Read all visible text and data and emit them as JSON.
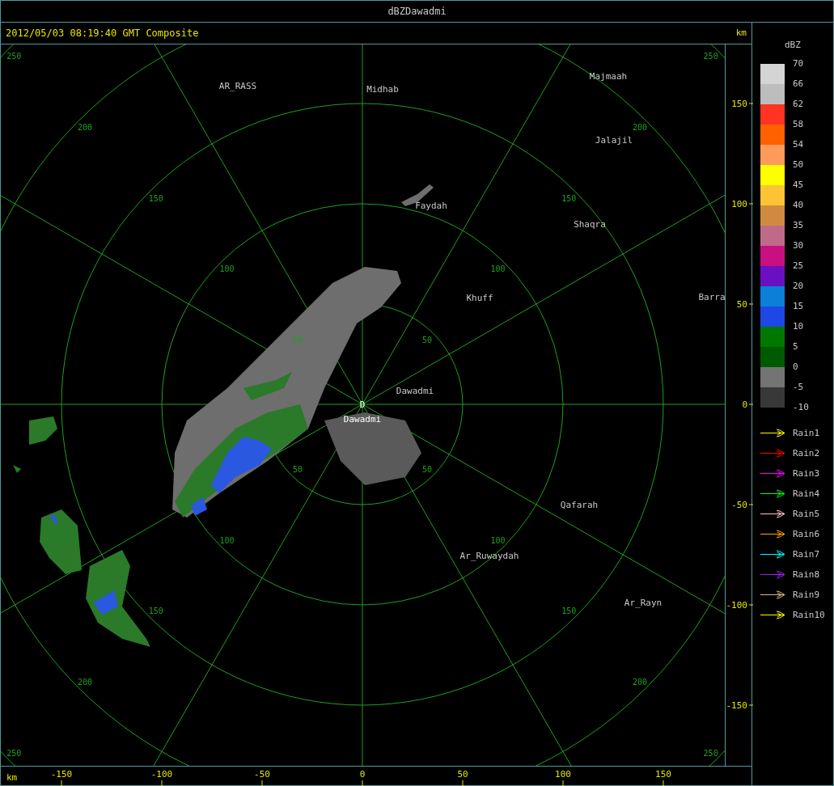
{
  "window": {
    "title": "dBZDawadmi"
  },
  "header": {
    "timestamp": "2012/05/03 08:19:40 GMT Composite",
    "unit": "km"
  },
  "map": {
    "places": [
      "AR_RASS",
      "Midhab",
      "Majmaah",
      "Jalajil",
      "Faydah",
      "Shaqra",
      "Khuff",
      "Barra",
      "Dawadmi",
      "Qafarah",
      "Ar_Ruwaydah",
      "Ar_Rayn"
    ],
    "site_marker": "D",
    "site_label": "Dawadmi",
    "rings": [
      {
        "labels": [
          "50",
          "50",
          "50",
          "50"
        ]
      },
      {
        "labels": [
          "100",
          "100",
          "100",
          "100"
        ]
      },
      {
        "labels": [
          "150",
          "150",
          "150",
          "150"
        ]
      },
      {
        "labels": [
          "200",
          "200",
          "200",
          "200"
        ]
      },
      {
        "labels": [
          "250",
          "250",
          "250",
          "250"
        ]
      }
    ]
  },
  "y_axis": {
    "ticks": [
      "150",
      "100",
      "50",
      "0",
      "-50",
      "-100",
      "-150"
    ]
  },
  "x_axis": {
    "unit": "km",
    "ticks": [
      "-150",
      "-100",
      "-50",
      "0",
      "50",
      "100",
      "150"
    ]
  },
  "legend": {
    "title": "dBZ",
    "scale": [
      {
        "label": "70",
        "color": "#d4d4d4"
      },
      {
        "label": "66",
        "color": "#bdbdbd"
      },
      {
        "label": "62",
        "color": "#ff3322"
      },
      {
        "label": "58",
        "color": "#ff6000"
      },
      {
        "label": "54",
        "color": "#ff9a5a"
      },
      {
        "label": "50",
        "color": "#ffff00"
      },
      {
        "label": "45",
        "color": "#fcc434"
      },
      {
        "label": "40",
        "color": "#d08a40"
      },
      {
        "label": "35",
        "color": "#bf6a88"
      },
      {
        "label": "30",
        "color": "#c81080"
      },
      {
        "label": "25",
        "color": "#6a10c0"
      },
      {
        "label": "20",
        "color": "#0a80d8"
      },
      {
        "label": "15",
        "color": "#1e48e6"
      },
      {
        "label": "10",
        "color": "#007800"
      },
      {
        "label": "5",
        "color": "#005a00"
      },
      {
        "label": "0",
        "color": "#747474"
      },
      {
        "label": "-5",
        "color": "#383838"
      }
    ],
    "bottom_label": "-10",
    "tracks": [
      {
        "label": "Rain1",
        "color": "#ffff00"
      },
      {
        "label": "Rain2",
        "color": "#ff0000"
      },
      {
        "label": "Rain3",
        "color": "#ff00ff"
      },
      {
        "label": "Rain4",
        "color": "#00ff00"
      },
      {
        "label": "Rain5",
        "color": "#ffc0cb"
      },
      {
        "label": "Rain6",
        "color": "#ffa500"
      },
      {
        "label": "Rain7",
        "color": "#00ffff"
      },
      {
        "label": "Rain8",
        "color": "#a020f0"
      },
      {
        "label": "Rain9",
        "color": "#deb887"
      },
      {
        "label": "Rain10",
        "color": "#ffff00"
      }
    ]
  }
}
